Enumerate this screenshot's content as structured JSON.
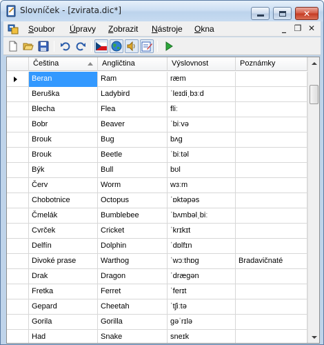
{
  "window": {
    "title": "Slovníček - [zvirata.dic*]",
    "caption_buttons": {
      "minimize": "minimize",
      "maximize": "maximize",
      "close": "✕"
    }
  },
  "menu": {
    "items": [
      {
        "label_acc": "S",
        "label_rest": "oubor"
      },
      {
        "label_acc": "Ú",
        "label_rest": "pravy"
      },
      {
        "label_acc": "Z",
        "label_rest": "obrazit"
      },
      {
        "label_acc": "N",
        "label_rest": "ástroje"
      },
      {
        "label_acc": "O",
        "label_rest": "kna"
      }
    ],
    "mdi_controls": {
      "minimize": "_",
      "restore": "❐",
      "close": "✕"
    }
  },
  "toolbar": {
    "buttons": [
      "new-document-icon",
      "open-folder-icon",
      "save-disk-icon",
      "undo-icon",
      "redo-icon",
      "czech-flag-icon",
      "globe-icon",
      "speaker-icon",
      "edit-note-icon",
      "play-icon"
    ]
  },
  "grid": {
    "columns": [
      "Čeština",
      "Angličtina",
      "Výslovnost",
      "Poznámky"
    ],
    "sorted_column": "Čeština",
    "rows": [
      [
        "Beran",
        "Ram",
        "ræm",
        ""
      ],
      [
        "Beruška",
        "Ladybird",
        "ˈleɪdiˌbɜːd",
        ""
      ],
      [
        "Blecha",
        "Flea",
        "fliː",
        ""
      ],
      [
        "Bobr",
        "Beaver",
        "ˈbiːvə",
        ""
      ],
      [
        "Brouk",
        "Bug",
        "bʌɡ",
        ""
      ],
      [
        "Brouk",
        "Beetle",
        "ˈbiːtəl",
        ""
      ],
      [
        "Býk",
        "Bull",
        "bʊl",
        ""
      ],
      [
        "Červ",
        "Worm",
        "wɜːm",
        ""
      ],
      [
        "Chobotnice",
        "Octopus",
        "ˈɒktəpəs",
        ""
      ],
      [
        "Čmelák",
        "Bumblebee",
        "ˈbʌmbəlˌbiː",
        ""
      ],
      [
        "Cvrček",
        "Cricket",
        "ˈkrɪkɪt",
        ""
      ],
      [
        "Delfín",
        "Dolphin",
        "ˈdɒlfɪn",
        ""
      ],
      [
        "Divoké prase",
        "Warthog",
        "ˈwɔːthɒɡ",
        "Bradavičnaté"
      ],
      [
        "Drak",
        "Dragon",
        "ˈdræɡən",
        ""
      ],
      [
        "Fretka",
        "Ferret",
        "ˈferɪt",
        ""
      ],
      [
        "Gepard",
        "Cheetah",
        "ˈtʃiːtə",
        ""
      ],
      [
        "Gorila",
        "Gorilla",
        "ɡəˈrɪlə",
        ""
      ],
      [
        "Had",
        "Snake",
        "sneɪk",
        ""
      ]
    ],
    "selected_row": 0,
    "row_pointer": "▶"
  },
  "colors": {
    "selection": "#3399ff",
    "titlebar": "#cddff3",
    "close_button": "#d35a43"
  }
}
